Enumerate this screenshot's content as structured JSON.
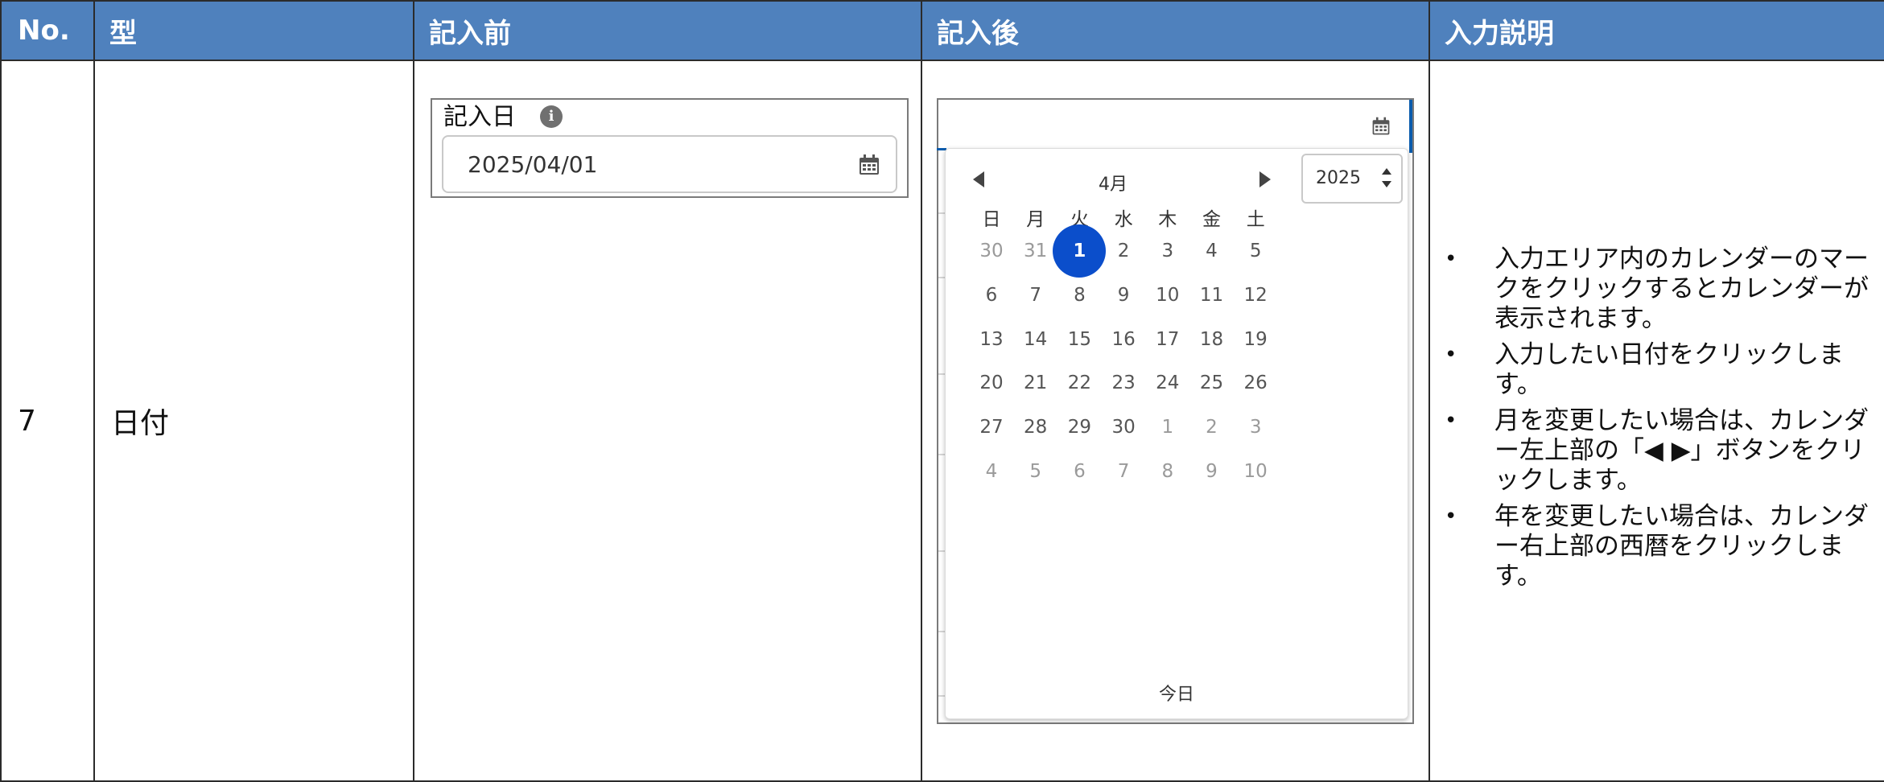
{
  "table": {
    "headers": {
      "no": "No.",
      "type": "型",
      "before": "記入前",
      "after": "記入後",
      "description": "入力説明"
    },
    "row": {
      "no": "7",
      "type": "日付"
    }
  },
  "before_field": {
    "label": "記入日",
    "info_icon": "info-icon",
    "value": "2025/04/01",
    "icon": "calendar-icon"
  },
  "datepicker": {
    "month": "4月",
    "year": "2025",
    "weekdays": [
      "日",
      "月",
      "火",
      "水",
      "木",
      "金",
      "土"
    ],
    "weeks": [
      [
        "30",
        "31",
        "1",
        "2",
        "3",
        "4",
        "5"
      ],
      [
        "6",
        "7",
        "8",
        "9",
        "10",
        "11",
        "12"
      ],
      [
        "13",
        "14",
        "15",
        "16",
        "17",
        "18",
        "19"
      ],
      [
        "20",
        "21",
        "22",
        "23",
        "24",
        "25",
        "26"
      ],
      [
        "27",
        "28",
        "29",
        "30",
        "1",
        "2",
        "3"
      ],
      [
        "4",
        "5",
        "6",
        "7",
        "8",
        "9",
        "10"
      ]
    ],
    "selected_day": "1",
    "today_label": "今日",
    "accent_color": "#0b4ecb"
  },
  "description": {
    "bullet": "•",
    "items": [
      "入力エリア内のカレンダーのマークをクリックするとカレンダーが表示されます。",
      "入力したい日付をクリックします。",
      "月を変更したい場合は、カレンダー左上部の「◀ ▶」ボタンをクリックします。",
      "年を変更したい場合は、カレンダー右上部の西暦をクリックします。"
    ]
  },
  "colors": {
    "header_bg": "#4f81bd",
    "header_text": "#ffffff"
  }
}
